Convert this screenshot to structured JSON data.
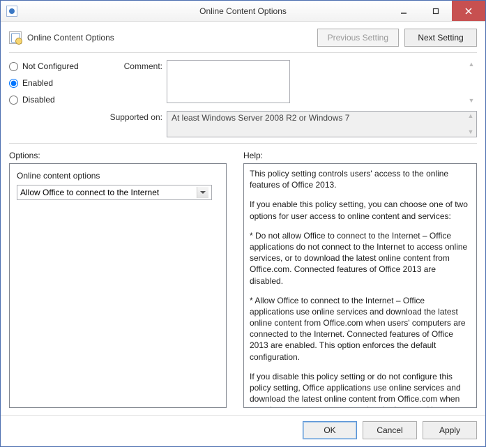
{
  "window": {
    "title": "Online Content Options"
  },
  "header": {
    "title": "Online Content Options",
    "prev_label": "Previous Setting",
    "next_label": "Next Setting"
  },
  "state": {
    "not_configured_label": "Not Configured",
    "enabled_label": "Enabled",
    "disabled_label": "Disabled",
    "selected": "enabled"
  },
  "fields": {
    "comment_label": "Comment:",
    "comment_value": "",
    "supported_label": "Supported on:",
    "supported_value": "At least Windows Server 2008 R2 or Windows 7"
  },
  "sections": {
    "options_label": "Options:",
    "help_label": "Help:"
  },
  "options": {
    "group_label": "Online content options",
    "selected_value": "Allow Office to connect to the Internet"
  },
  "help": {
    "p1": "This policy setting controls users' access to the online features of Office 2013.",
    "p2": "If you enable this policy setting, you can choose one of two options for user access to online content and services:",
    "p3": "* Do not allow Office to connect to the Internet – Office applications do not connect to the Internet to access online services, or to download the latest online content from Office.com. Connected features of Office 2013 are disabled.",
    "p4": "* Allow Office to connect to the Internet – Office applications use online services and download the latest online content from Office.com when users' computers are connected to the Internet. Connected features of Office 2013 are enabled. This option enforces the default configuration.",
    "p5": "If you disable this policy setting or do not configure this policy setting, Office applications use online services and download the latest online content from Office.com when users' computers are connected to the Internet. Users can change this behavior by"
  },
  "footer": {
    "ok_label": "OK",
    "cancel_label": "Cancel",
    "apply_label": "Apply"
  }
}
